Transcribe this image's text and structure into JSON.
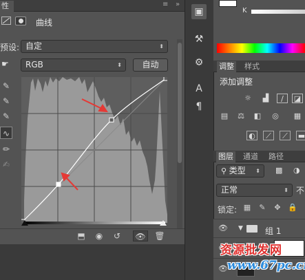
{
  "properties": {
    "tab_label": "性",
    "panel_title": "曲线",
    "preset_label": "预设:",
    "preset_value": "自定",
    "channel_value": "RGB",
    "auto_label": "自动"
  },
  "curve": {
    "x": [
      0,
      0.25,
      0.62,
      1.0
    ],
    "y": [
      0,
      0.26,
      0.71,
      1.0
    ]
  },
  "color_panel": {
    "k_label": "K"
  },
  "adjustments": {
    "tabs": [
      {
        "label": "调整"
      },
      {
        "label": "样式"
      }
    ],
    "title": "添加调整"
  },
  "layers": {
    "tabs": [
      {
        "label": "图层"
      },
      {
        "label": "通道"
      },
      {
        "label": "路径"
      }
    ],
    "kind_value": "类型",
    "blend_value": "正常",
    "opacity_label": "不",
    "lock_label": "锁定:",
    "group_name": "组 1"
  },
  "watermark": {
    "line1": "资源批发网",
    "line2": "www.67pc.cn"
  },
  "colors": {
    "panel": "#535353",
    "dark": "#3a3a3a",
    "arrow": "#e53935"
  }
}
